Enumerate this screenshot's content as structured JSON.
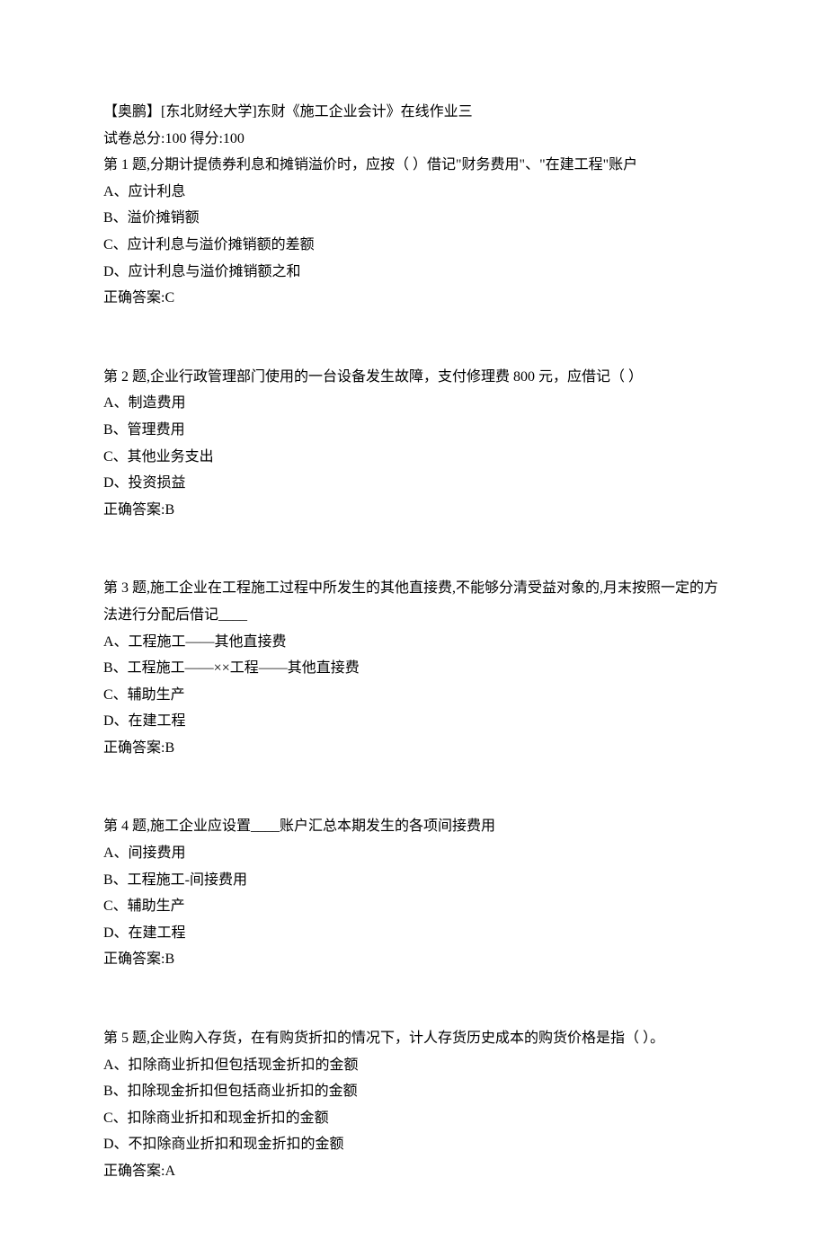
{
  "header": {
    "title": "【奥鹏】[东北财经大学]东财《施工企业会计》在线作业三",
    "score_line": "试卷总分:100    得分:100"
  },
  "questions": [
    {
      "text": "第 1 题,分期计提债券利息和摊销溢价时，应按（       ）借记\"财务费用\"、\"在建工程\"账户",
      "options": [
        "A、应计利息",
        "B、溢价摊销额",
        "C、应计利息与溢价摊销额的差额",
        "D、应计利息与溢价摊销额之和"
      ],
      "answer": "正确答案:C"
    },
    {
      "text": "第 2 题,企业行政管理部门使用的一台设备发生故障，支付修理费 800 元，应借记（        ）",
      "options": [
        "A、制造费用",
        "B、管理费用",
        "C、其他业务支出",
        "D、投资损益"
      ],
      "answer": "正确答案:B"
    },
    {
      "text": "第 3 题,施工企业在工程施工过程中所发生的其他直接费,不能够分清受益对象的,月末按照一定的方法进行分配后借记____",
      "options": [
        "A、工程施工——其他直接费",
        "B、工程施工——××工程——其他直接费",
        "C、辅助生产",
        "D、在建工程"
      ],
      "answer": "正确答案:B"
    },
    {
      "text": "第 4 题,施工企业应设置____账户汇总本期发生的各项间接费用",
      "options": [
        "A、间接费用",
        "B、工程施工-间接费用",
        "C、辅助生产",
        "D、在建工程"
      ],
      "answer": "正确答案:B"
    },
    {
      "text": "第 5 题,企业购入存货，在有购货折扣的情况下，计人存货历史成本的购货价格是指（         ）。",
      "options": [
        "A、扣除商业折扣但包括现金折扣的金额",
        "B、扣除现金折扣但包括商业折扣的金额",
        "C、扣除商业折扣和现金折扣的金额",
        "D、不扣除商业折扣和现金折扣的金额"
      ],
      "answer": "正确答案:A"
    }
  ]
}
